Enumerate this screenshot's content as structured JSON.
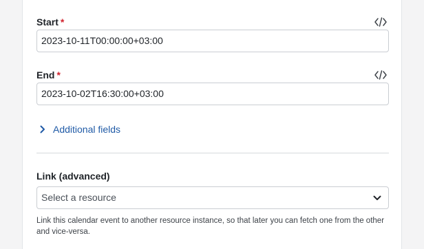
{
  "start": {
    "label": "Start",
    "required_mark": "*",
    "value": "2023-10-11T00:00:00+03:00",
    "code_icon": "code-icon"
  },
  "end": {
    "label": "End",
    "required_mark": "*",
    "value": "2023-10-02T16:30:00+03:00",
    "code_icon": "code-icon"
  },
  "additional_fields": {
    "label": "Additional fields",
    "icon": "chevron-right-icon"
  },
  "link": {
    "label": "Link (advanced)",
    "placeholder": "Select a resource",
    "icon": "chevron-down-icon",
    "help": "Link this calendar event to another resource instance, so that later you can fetch one from the other and vice-versa."
  },
  "colors": {
    "accent_link": "#1f5aa6",
    "required": "#d1242f",
    "border": "#c9cdd2"
  }
}
